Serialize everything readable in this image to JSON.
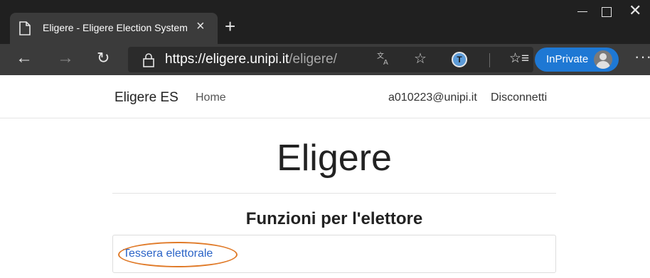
{
  "browser": {
    "tab_title": "Eligere - Eligere Election System",
    "tab_close": "×",
    "new_tab": "+",
    "window_controls": {
      "minimize": "—",
      "close": "✕"
    },
    "nav": {
      "back": "←",
      "forward": "→",
      "refresh": "↻"
    },
    "address": {
      "url_host": "https://eligere.unipi.it",
      "url_path": "/eligere/"
    },
    "icons": {
      "translate": "䷀",
      "star": "☆",
      "extension": "T",
      "favorites": "☆≡"
    },
    "inprivate_label": "InPrivate",
    "more": "···",
    "colors": {
      "chrome_dark": "#202020",
      "toolbar": "#3b3b3b",
      "inprivate": "#1e78d4"
    }
  },
  "site_nav": {
    "brand": "Eligere ES",
    "home": "Home",
    "user_email": "a010223@unipi.it",
    "logout": "Disconnetti"
  },
  "main": {
    "heading": "Eligere",
    "section_title": "Funzioni per l'elettore",
    "items": [
      {
        "label": "Tessera elettorale"
      }
    ],
    "colors": {
      "link": "#2a63c7",
      "highlight": "#e07a28"
    }
  }
}
